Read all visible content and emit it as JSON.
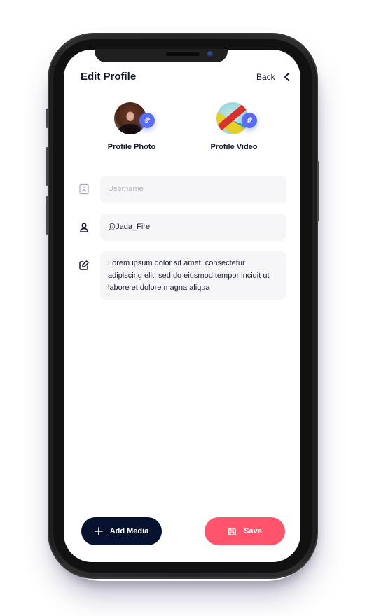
{
  "header": {
    "title": "Edit Profile",
    "back_label": "Back",
    "back_icon": "chevron-left-icon"
  },
  "media": [
    {
      "label": "Profile Photo",
      "type": "photo",
      "badge_icon": "paperclip-icon"
    },
    {
      "label": "Profile Video",
      "type": "video",
      "badge_icon": "paperclip-icon"
    }
  ],
  "form": {
    "name": {
      "icon": "id-badge-icon",
      "value": "",
      "placeholder": "Username"
    },
    "username": {
      "icon": "user-icon",
      "value": "@Jada_Fire",
      "placeholder": ""
    },
    "bio": {
      "icon": "edit-icon",
      "value": "Lorem ipsum dolor sit amet, consectetur adipiscing elit, sed do eiusmod tempor incidit ut labore et dolore magna aliqua",
      "placeholder": ""
    }
  },
  "actions": {
    "add_media_label": "Add Media",
    "add_media_icon": "plus-icon",
    "save_label": "Save",
    "save_icon": "save-icon"
  },
  "colors": {
    "accent_blue": "#5a6cf0",
    "primary_dark": "#07132e",
    "save_red": "#ff546c",
    "field_bg": "#f6f6f8",
    "text_dark": "#121830"
  }
}
